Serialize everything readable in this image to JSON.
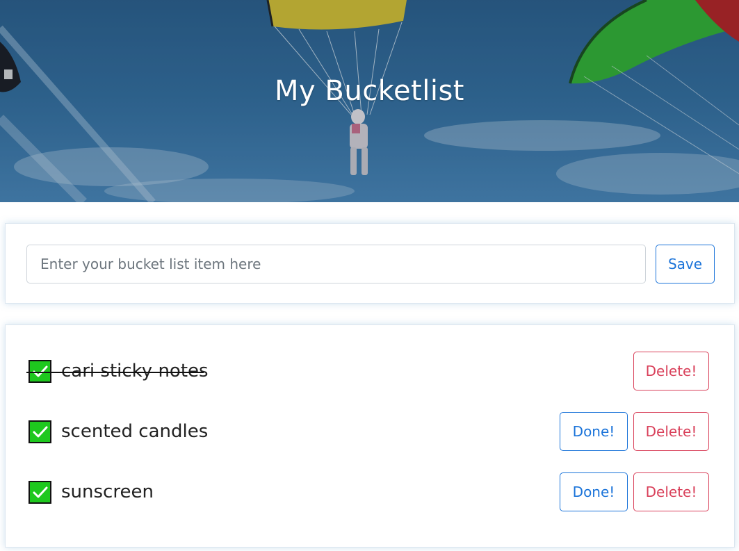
{
  "header": {
    "title": "My Bucketlist"
  },
  "form": {
    "placeholder": "Enter your bucket list item here",
    "value": "",
    "save_label": "Save"
  },
  "list": {
    "items": [
      {
        "text": "cari sticky notes",
        "done": true,
        "done_label": "",
        "delete_label": "Delete!"
      },
      {
        "text": "scented candles",
        "done": false,
        "done_label": "Done!",
        "delete_label": "Delete!"
      },
      {
        "text": "sunscreen",
        "done": false,
        "done_label": "Done!",
        "delete_label": "Delete!"
      }
    ]
  },
  "icons": {
    "checkbox": "checkmark-icon"
  },
  "colors": {
    "primary": "#1a73d9",
    "danger": "#d9405a",
    "check_green": "#1ec81e",
    "hero_sky": "#2f6a9c"
  }
}
